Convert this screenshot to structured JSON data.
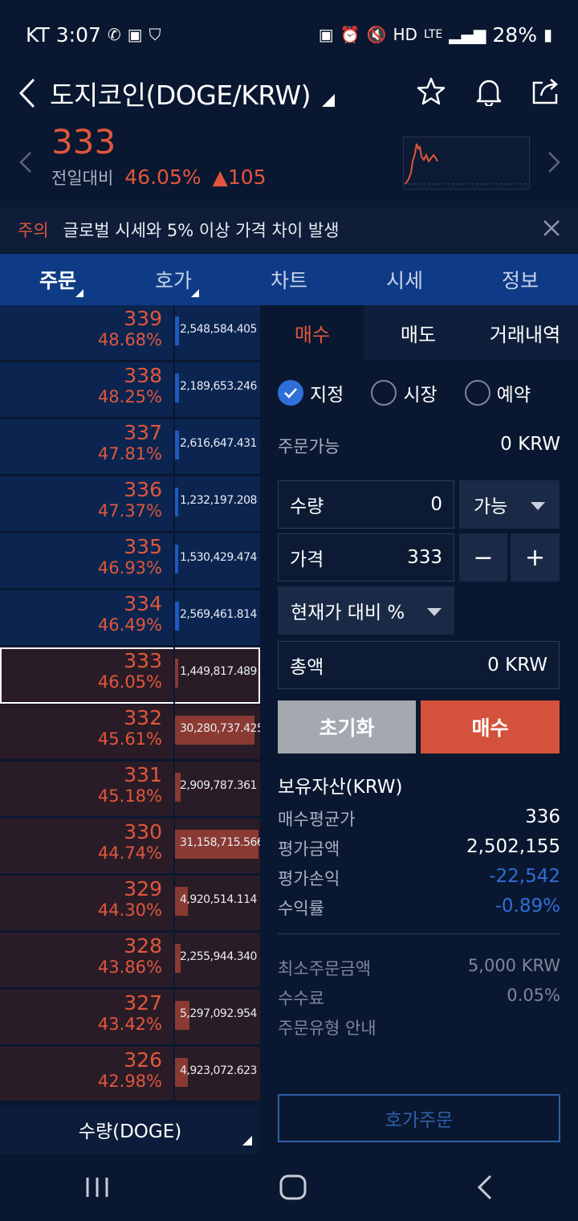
{
  "status_bar": {
    "carrier": "KT",
    "time": "3:07",
    "network": "LTE",
    "battery": "28%"
  },
  "header": {
    "title": "도지코인(DOGE/KRW)"
  },
  "price": {
    "current": "333",
    "change_label": "전일대비",
    "change_pct": "46.05%",
    "change_abs": "▲105"
  },
  "notice": {
    "tag": "주의",
    "text": "글로벌 시세와 5% 이상 가격 차이 발생"
  },
  "tabs": [
    {
      "label": "주문"
    },
    {
      "label": "호가"
    },
    {
      "label": "차트"
    },
    {
      "label": "시세"
    },
    {
      "label": "정보"
    }
  ],
  "order_book": {
    "rows": [
      {
        "price": "339",
        "pct": "48.68%",
        "qty": "2,548,584.405",
        "side": "ask",
        "level": 0.05
      },
      {
        "price": "338",
        "pct": "48.25%",
        "qty": "2,189,653.246",
        "side": "ask",
        "level": 0.05
      },
      {
        "price": "337",
        "pct": "47.81%",
        "qty": "2,616,647.431",
        "side": "ask",
        "level": 0.05
      },
      {
        "price": "336",
        "pct": "47.37%",
        "qty": "1,232,197.208",
        "side": "ask",
        "level": 0.03
      },
      {
        "price": "335",
        "pct": "46.93%",
        "qty": "1,530,429.474",
        "side": "ask",
        "level": 0.03
      },
      {
        "price": "334",
        "pct": "46.49%",
        "qty": "2,569,461.814",
        "side": "ask",
        "level": 0.05
      },
      {
        "price": "333",
        "pct": "46.05%",
        "qty": "1,449,817.489",
        "side": "bid",
        "level": 0.03
      },
      {
        "price": "332",
        "pct": "45.61%",
        "qty": "30,280,737.425",
        "side": "bid",
        "level": 0.95
      },
      {
        "price": "331",
        "pct": "45.18%",
        "qty": "2,909,787.361",
        "side": "bid",
        "level": 0.07
      },
      {
        "price": "330",
        "pct": "44.74%",
        "qty": "31,158,715.566",
        "side": "bid",
        "level": 1.0
      },
      {
        "price": "329",
        "pct": "44.30%",
        "qty": "4,920,514.114",
        "side": "bid",
        "level": 0.15
      },
      {
        "price": "328",
        "pct": "43.86%",
        "qty": "2,255,944.340",
        "side": "bid",
        "level": 0.07
      },
      {
        "price": "327",
        "pct": "43.42%",
        "qty": "5,297,092.954",
        "side": "bid",
        "level": 0.17
      },
      {
        "price": "326",
        "pct": "42.98%",
        "qty": "4,923,072.623",
        "side": "bid",
        "level": 0.15
      }
    ],
    "footer_label": "수량(DOGE)"
  },
  "order_panel": {
    "tabs": {
      "buy": "매수",
      "sell": "매도",
      "history": "거래내역"
    },
    "order_types": {
      "limit": "지정",
      "market": "시장",
      "reserve": "예약"
    },
    "available_label": "주문가능",
    "available_value": "0 KRW",
    "qty_label": "수량",
    "qty_value": "0",
    "qty_select": "가능",
    "price_label": "가격",
    "price_value": "333",
    "minus": "−",
    "plus": "+",
    "pct_select": "현재가 대비 %",
    "total_label": "총액",
    "total_value": "0 KRW",
    "reset_label": "초기화",
    "buy_label": "매수"
  },
  "holdings": {
    "title": "보유자산(KRW)",
    "avg_price_label": "매수평균가",
    "avg_price_value": "336",
    "eval_amount_label": "평가금액",
    "eval_amount_value": "2,502,155",
    "eval_pl_label": "평가손익",
    "eval_pl_value": "-22,542",
    "return_label": "수익률",
    "return_value": "-0.89%"
  },
  "order_info": {
    "min_label": "최소주문금액",
    "min_value": "5,000 KRW",
    "fee_label": "수수료",
    "fee_value": "0.05%",
    "guide_label": "주문유형 안내"
  },
  "hoga_order_label": "호가주문",
  "colors": {
    "up": "#e0573c",
    "down": "#2f6fd8",
    "tab_bar": "#0f3b86",
    "background": "#0a1730"
  }
}
